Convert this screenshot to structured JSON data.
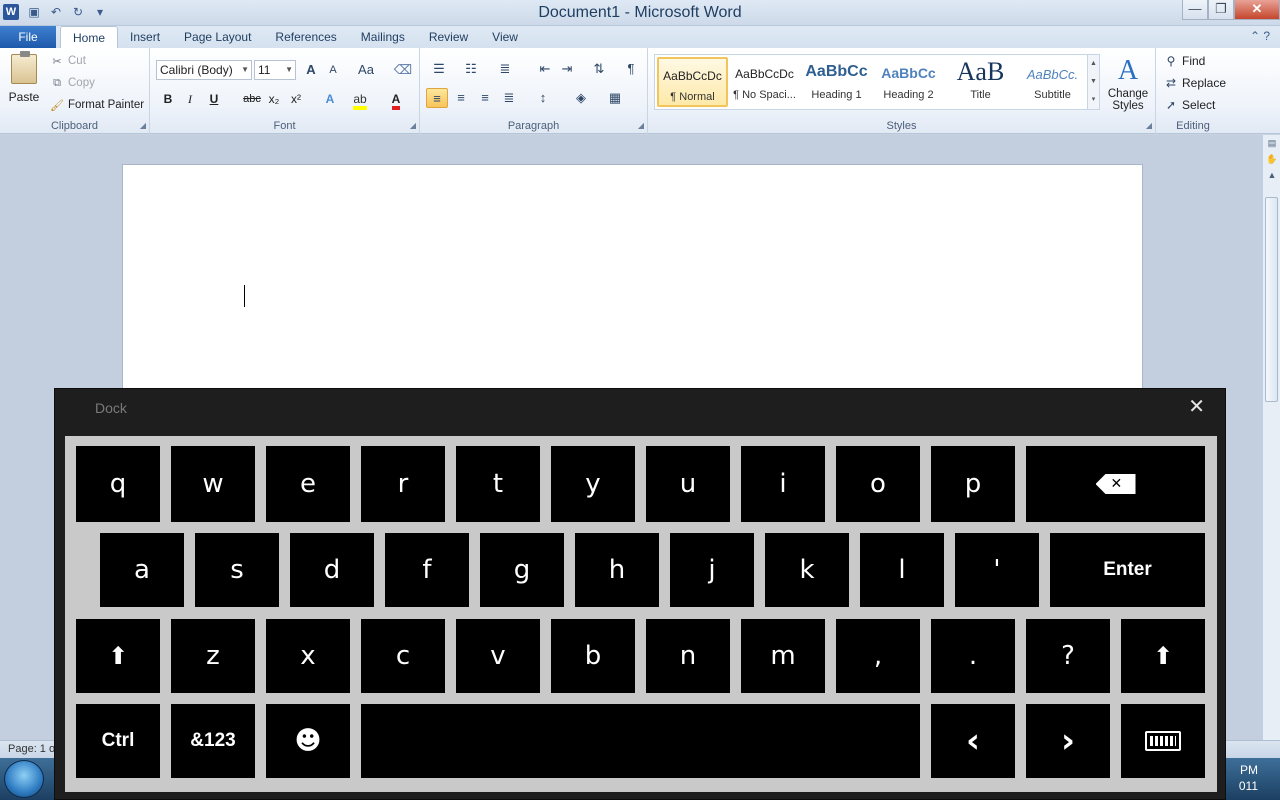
{
  "window": {
    "title": "Document1  -  Microsoft Word",
    "app_icon": "W"
  },
  "qat": {
    "save": "save-icon",
    "undo": "undo-icon",
    "redo": "redo-icon",
    "customize": "dropdown-icon"
  },
  "window_controls": {
    "minimize": "—",
    "maximize": "❐",
    "close": "✕"
  },
  "ribbon_tabs": [
    "Insert",
    "Page Layout",
    "References",
    "Mailings",
    "Review",
    "View"
  ],
  "file_tab": "File",
  "active_tab": "Home",
  "clipboard": {
    "paste": "Paste",
    "cut": "Cut",
    "copy": "Copy",
    "format_painter": "Format Painter",
    "label": "Clipboard"
  },
  "font": {
    "name": "Calibri (Body)",
    "size": "11",
    "grow": "A",
    "shrink": "A",
    "change_case": "Aa",
    "bold": "B",
    "italic": "I",
    "underline": "U",
    "strike": "abc",
    "subscript": "x₂",
    "superscript": "x²",
    "label": "Font"
  },
  "paragraph": {
    "label": "Paragraph",
    "pilcrow": "¶"
  },
  "styles": {
    "label": "Styles",
    "items": [
      {
        "sample": "AaBbCcDc",
        "name": "¶ Normal"
      },
      {
        "sample": "AaBbCcDc",
        "name": "¶ No Spaci..."
      },
      {
        "sample": "AaBbCc",
        "name": "Heading 1"
      },
      {
        "sample": "AaBbCc",
        "name": "Heading 2"
      },
      {
        "sample": "AaB",
        "name": "Title"
      },
      {
        "sample": "AaBbCc.",
        "name": "Subtitle"
      }
    ],
    "change_styles": "Change Styles"
  },
  "editing": {
    "find": "Find",
    "replace": "Replace",
    "select": "Select",
    "label": "Editing"
  },
  "status": {
    "page": "Page: 1 o"
  },
  "taskbar": {
    "clock_line1": "PM",
    "clock_line2": "011"
  },
  "keyboard": {
    "title": "Dock",
    "close": "✕",
    "row1": [
      "q",
      "w",
      "e",
      "r",
      "t",
      "y",
      "u",
      "i",
      "o",
      "p"
    ],
    "row2": [
      "a",
      "s",
      "d",
      "f",
      "g",
      "h",
      "j",
      "k",
      "l",
      "'"
    ],
    "row3": [
      "z",
      "x",
      "c",
      "v",
      "b",
      "n",
      "m",
      ",",
      ".",
      "?"
    ],
    "enter": "Enter",
    "shift": "🡅",
    "ctrl": "Ctrl",
    "symbols": "&123",
    "emoji": "☻",
    "left": "‹",
    "right": "›"
  }
}
